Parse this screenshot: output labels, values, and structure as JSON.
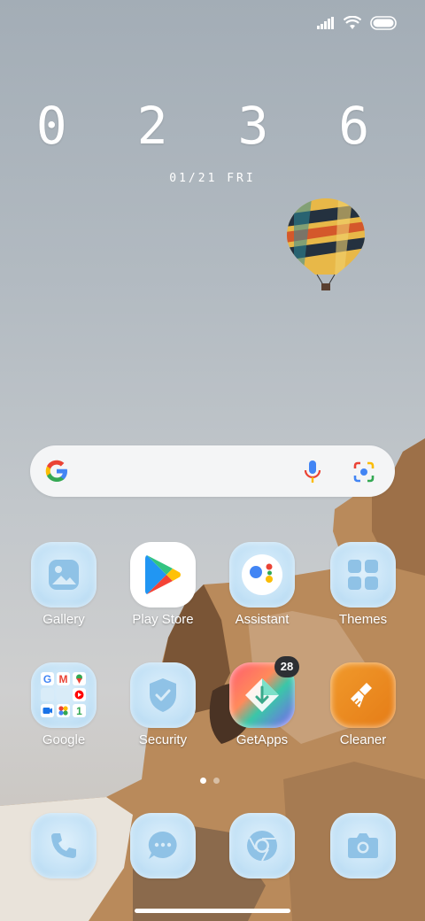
{
  "status_bar": {
    "icons": [
      "signal-icon",
      "wifi-icon",
      "battery-icon"
    ]
  },
  "clock": {
    "time": "0 2 3 6",
    "hour": "02",
    "minute": "36",
    "date": "01/21 FRI"
  },
  "search_bar": {
    "icons": [
      "google-logo-icon",
      "mic-icon",
      "lens-icon"
    ]
  },
  "apps": [
    {
      "label": "Gallery",
      "icon": "gallery-icon"
    },
    {
      "label": "Play Store",
      "icon": "play-store-icon"
    },
    {
      "label": "Assistant",
      "icon": "assistant-icon"
    },
    {
      "label": "Themes",
      "icon": "themes-icon"
    },
    {
      "label": "Google",
      "icon": "google-folder-icon"
    },
    {
      "label": "Security",
      "icon": "security-icon"
    },
    {
      "label": "GetApps",
      "icon": "getapps-icon",
      "badge": "28"
    },
    {
      "label": "Cleaner",
      "icon": "cleaner-icon"
    }
  ],
  "page_indicator": {
    "pages": 2,
    "current": 1
  },
  "dock": [
    {
      "icon": "phone-icon"
    },
    {
      "icon": "messages-icon"
    },
    {
      "icon": "chrome-icon"
    },
    {
      "icon": "camera-icon"
    }
  ],
  "colors": {
    "tile": "#c4e2f6",
    "icon_glyph": "#8fc2e6",
    "cleaner": "#e98a1f"
  }
}
